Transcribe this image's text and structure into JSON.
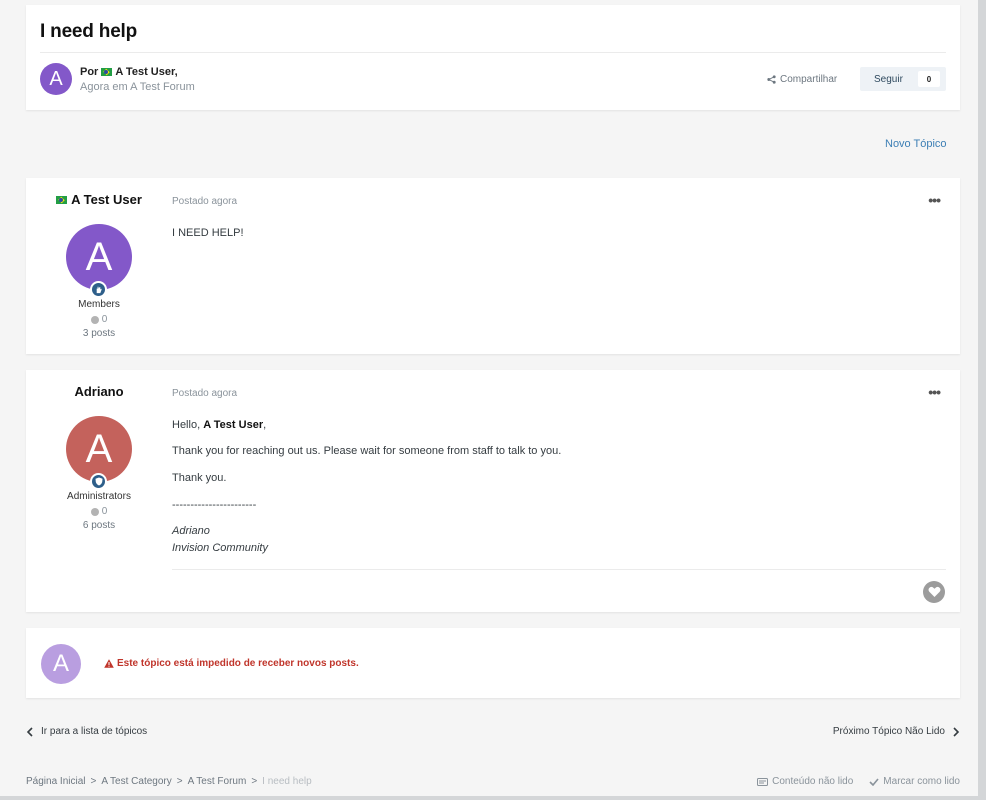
{
  "topic": {
    "title": "I need help",
    "by_prefix": "Por",
    "author": "A Test User,",
    "avatar_letter": "A",
    "sub_line": "Agora em A Test Forum",
    "share_label": "Compartilhar",
    "follow_label": "Seguir",
    "follow_count": "0",
    "new_topic_label": "Novo Tópico"
  },
  "posts": [
    {
      "author": "A Test User",
      "avatar_letter": "A",
      "avatar_color": "#8358c9",
      "group": "Members",
      "reputation": "0",
      "post_count": "3 posts",
      "date": "Postado agora",
      "body": [
        "I NEED HELP!"
      ]
    },
    {
      "author": "Adriano",
      "avatar_letter": "A",
      "avatar_color": "#c4625c",
      "group": "Administrators",
      "reputation": "0",
      "post_count": "6 posts",
      "date": "Postado agora",
      "greeting_prefix": "Hello,",
      "greeting_name": "A Test User",
      "greeting_suffix": ",",
      "line2": "Thank you for reaching out us. Please wait for someone from staff to talk to you.",
      "line3": "Thank you.",
      "divider": "-----------------------",
      "sig1": "Adriano",
      "sig2": "Invision Community"
    }
  ],
  "locked": {
    "avatar_letter": "A",
    "message": "Este tópico está impedido de receber novos posts."
  },
  "nav": {
    "prev": "Ir para a lista de tópicos",
    "next": "Próximo Tópico Não Lido"
  },
  "breadcrumb": [
    "Página Inicial",
    ">",
    "A Test Category",
    ">",
    "A Test Forum",
    ">",
    "I need help"
  ],
  "footer": {
    "unread": "Conteúdo não lido",
    "mark_read": "Marcar como lido"
  },
  "icons": [
    "share-icon",
    "more-icon",
    "hand-icon",
    "shield-icon",
    "heart-icon",
    "warning-icon",
    "chevron-left-icon",
    "chevron-right-icon",
    "unread-icon",
    "check-icon",
    "flag-icon"
  ]
}
